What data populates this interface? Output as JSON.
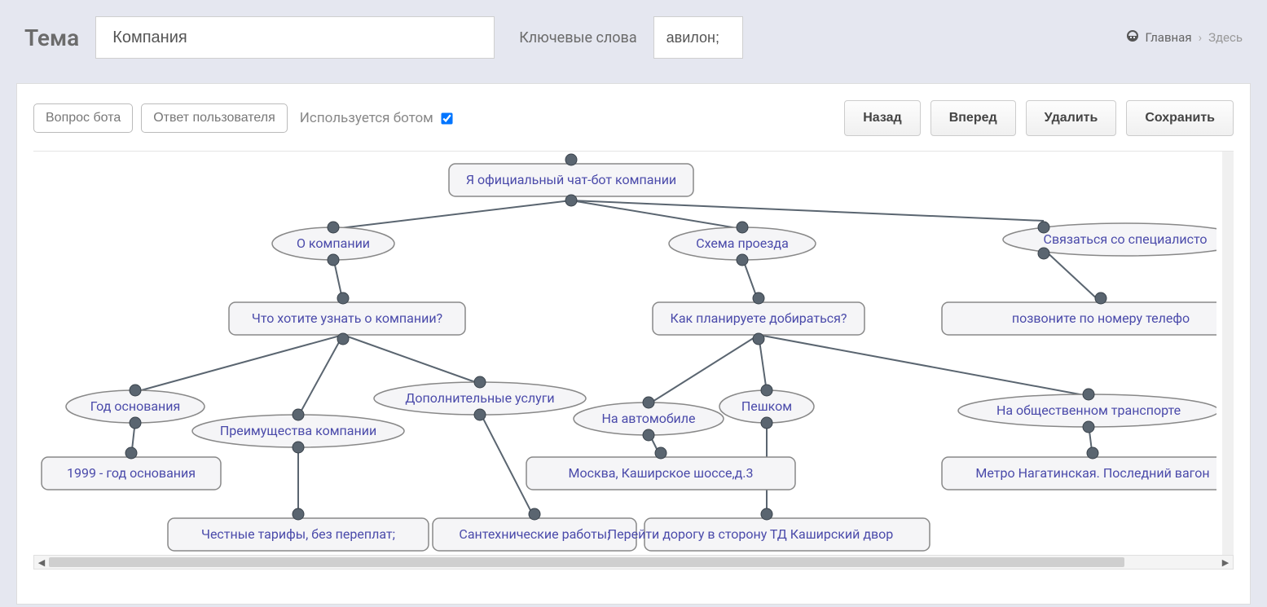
{
  "header": {
    "title": "Тема",
    "topic_value": "Компания",
    "keywords_label": "Ключевые слова",
    "keywords_value": "авилон;"
  },
  "breadcrumb": {
    "home": "Главная",
    "here": "Здесь"
  },
  "toolbar": {
    "bot_question": "Вопрос бота",
    "user_answer": "Ответ пользователя",
    "used_by_bot": "Используется ботом",
    "back": "Назад",
    "forward": "Вперед",
    "delete": "Удалить",
    "save": "Сохранить"
  },
  "diagram": {
    "root": "Я официальный чат-бот компании",
    "branch1": {
      "label": "О компании",
      "q": "Что хотите узнать о компании?",
      "a1": "Год основания",
      "a1r": "1999 - год основания",
      "a2": "Преимущества компании",
      "a2r": "Честные тарифы, без переплат;",
      "a3": "Дополнительные услуги",
      "a3r": "Сантехнические работы;"
    },
    "branch2": {
      "label": "Схема проезда",
      "q": "Как планируете добираться?",
      "a1": "На автомобиле",
      "a1r": "Москва, Каширское шоссе,д.3",
      "a2": "Пешком",
      "a2r": "Перейти дорогу в сторону ТД Каширский двор",
      "a3": "На общественном транспорте",
      "a3r": "Метро Нагатинская. Последний вагон"
    },
    "branch3": {
      "label": "Связаться со специалисто",
      "r": "позвоните по номеру телефо"
    }
  }
}
